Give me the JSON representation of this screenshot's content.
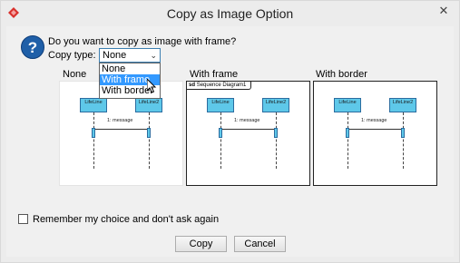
{
  "window": {
    "title": "Copy as Image Option",
    "close_glyph": "✕"
  },
  "prompt": {
    "question": "Do you want to copy as image with frame?",
    "copy_type_label": "Copy type:"
  },
  "copy_type_select": {
    "selected": "None",
    "options": [
      "None",
      "With frame",
      "With border"
    ],
    "highlighted_option": "With frame"
  },
  "previews": [
    {
      "label": "None",
      "frame_tag": null
    },
    {
      "label": "With frame",
      "frame_tag": {
        "prefix": "sd",
        "name": "Sequence Diagram1"
      }
    },
    {
      "label": "With border",
      "frame_tag": null
    }
  ],
  "diagram": {
    "lifeline1": "LifeLine",
    "lifeline2": "LifeLine2",
    "message": "1: message"
  },
  "remember_checkbox": {
    "label": "Remember my choice and don't ask again",
    "checked": false
  },
  "buttons": {
    "copy": "Copy",
    "cancel": "Cancel"
  },
  "icons": {
    "app": "app-logo-icon",
    "question": "question-icon",
    "arrow": "chevron-down-icon",
    "cursor": "mouse-pointer-icon"
  },
  "colors": {
    "lifeline_fill": "#5ec8e9",
    "lifeline_border": "#2b6c9f",
    "selection": "#3399ff",
    "question_icon": "#1f5fa8"
  }
}
